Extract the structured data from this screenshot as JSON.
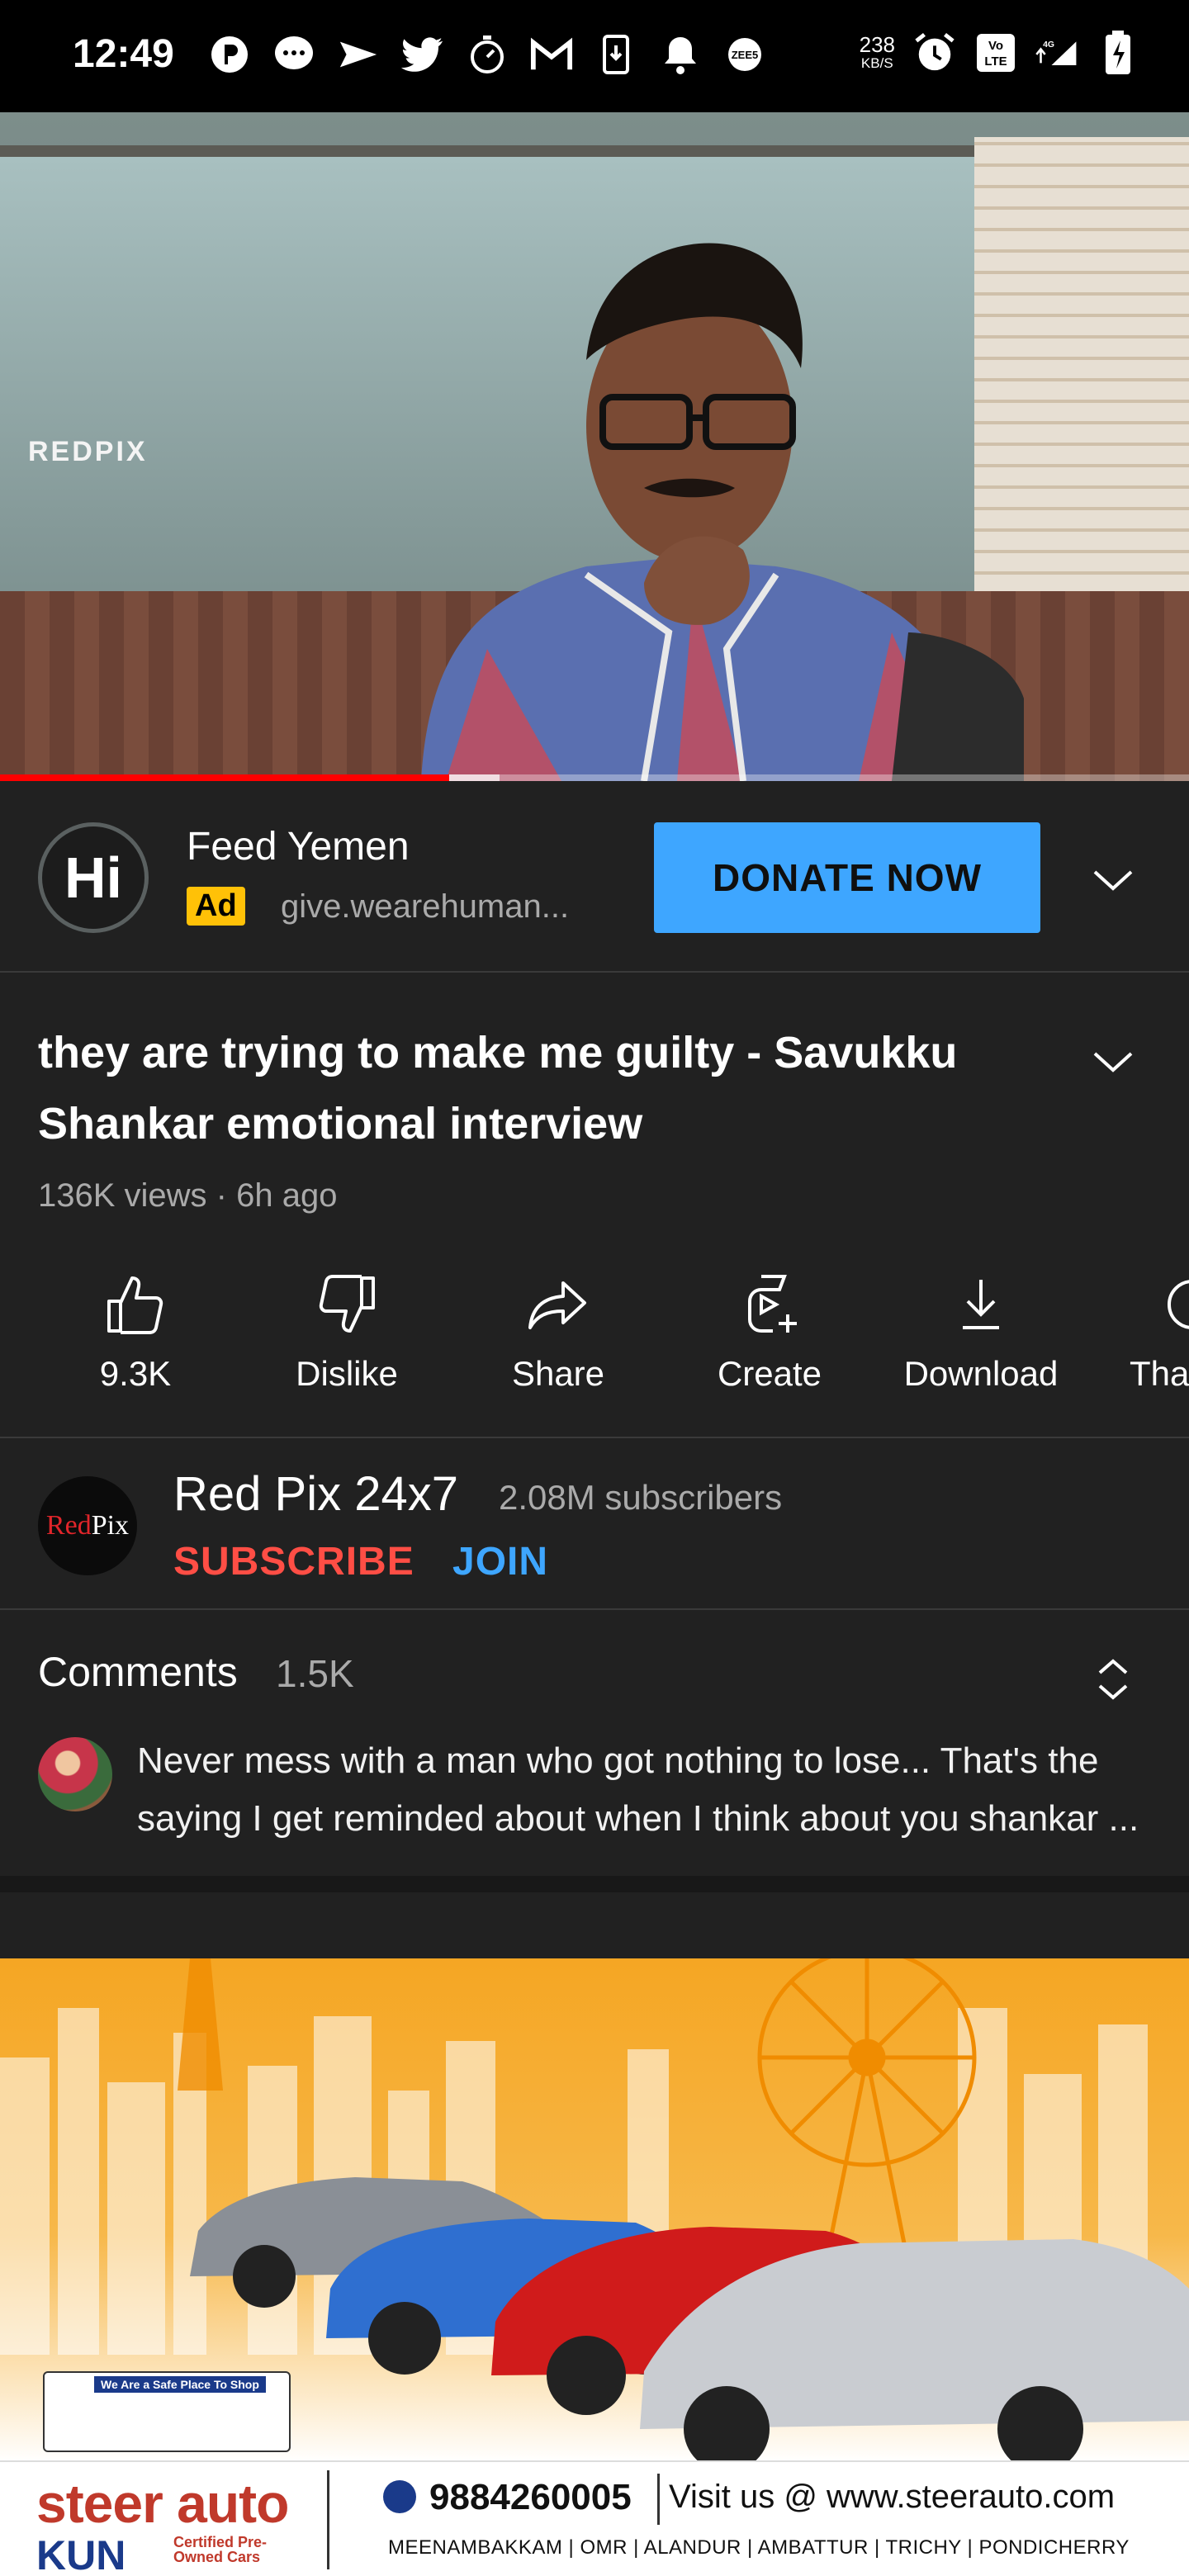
{
  "status_bar": {
    "time": "12:49",
    "speed_value": "238",
    "speed_unit": "KB/S",
    "network": "4G",
    "icons": [
      "p-app-icon",
      "chat-bubble-icon",
      "send-icon",
      "twitter-icon",
      "stopwatch-icon",
      "gmail-icon",
      "download-icon",
      "bell-icon",
      "zee5-icon",
      "alarm-icon",
      "volte-icon",
      "signal-icon",
      "battery-charging-icon"
    ]
  },
  "video": {
    "watermark": "REDPIX",
    "progress_played": 0.378,
    "progress_buffered": 0.42
  },
  "ad": {
    "logo_text": "Hi",
    "title": "Feed Yemen",
    "badge": "Ad",
    "url": "give.wearehuman...",
    "cta": "DONATE NOW",
    "colors": {
      "badge": "#ffc107",
      "cta": "#3ea6ff"
    }
  },
  "video_info": {
    "title": "they are trying to make me guilty - Savukku Shankar emotional interview",
    "meta": "136K views · 6h ago"
  },
  "actions": [
    {
      "icon": "thumbs-up-icon",
      "label": "9.3K"
    },
    {
      "icon": "thumbs-down-icon",
      "label": "Dislike"
    },
    {
      "icon": "share-icon",
      "label": "Share"
    },
    {
      "icon": "create-icon",
      "label": "Create"
    },
    {
      "icon": "download-icon",
      "label": "Download"
    },
    {
      "icon": "thanks-icon",
      "label": "Tha"
    }
  ],
  "channel": {
    "avatar_red": "Red",
    "avatar_white": "Pix",
    "name": "Red Pix 24x7",
    "subscribers": "2.08M subscribers",
    "subscribe": "SUBSCRIBE",
    "join": "JOIN",
    "colors": {
      "subscribe": "#ff4e45",
      "join": "#3ea6ff"
    }
  },
  "comments": {
    "heading": "Comments",
    "count": "1.5K",
    "top_comment": "Never mess with a man who got nothing to lose... That's the saying I get reminded about when I think about you shankar ..."
  },
  "banner": {
    "safe_label": "We Are a Safe Place To Shop",
    "brand": "steer auto",
    "brand_sub": "KUN",
    "certified": "Certified Pre-Owned Cars",
    "phone": "9884260005",
    "visit": "Visit us @ www.steerauto.com",
    "locations": "MEENAMBAKKAM | OMR | ALANDUR | AMBATTUR | TRICHY | PONDICHERRY"
  }
}
